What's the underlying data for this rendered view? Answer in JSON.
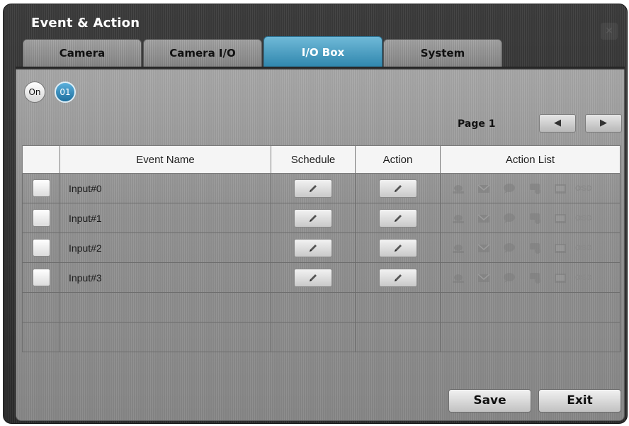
{
  "window": {
    "title": "Event & Action",
    "close_glyph": "✕"
  },
  "tabs": [
    {
      "label": "Camera",
      "active": false
    },
    {
      "label": "Camera I/O",
      "active": false
    },
    {
      "label": "I/O Box",
      "active": true
    },
    {
      "label": "System",
      "active": false
    }
  ],
  "toggles": {
    "on_label": "On",
    "channel_label": "01"
  },
  "pagination": {
    "label": "Page 1",
    "prev_glyph": "◀",
    "next_glyph": "▶"
  },
  "table": {
    "headers": [
      "",
      "Event Name",
      "Schedule",
      "Action",
      "Action List"
    ],
    "rows": [
      {
        "checked": false,
        "event_name": "Input#0"
      },
      {
        "checked": false,
        "event_name": "Input#1"
      },
      {
        "checked": false,
        "event_name": "Input#2"
      },
      {
        "checked": false,
        "event_name": "Input#3"
      }
    ],
    "action_list_icons": [
      "alarm-light-icon",
      "email-icon",
      "message-icon",
      "ptz-preset-icon",
      "snapshot-icon"
    ],
    "osd_label": "OSD"
  },
  "footer": {
    "save_label": "Save",
    "exit_label": "Exit"
  },
  "colors": {
    "accent": "#2f86ad",
    "panel": "#999999",
    "header_bg": "#f5f5f5"
  }
}
